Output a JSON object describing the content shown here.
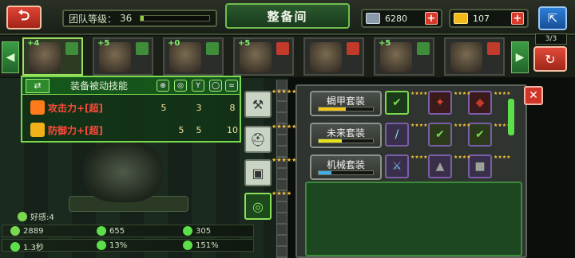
{
  "header": {
    "back_icon": "back-arrow-icon",
    "level_label": "团队等级：",
    "level_value": "36",
    "level_progress": 0.04,
    "title": "整备间",
    "resource1_value": "6280",
    "resource2_value": "107",
    "plus": "+",
    "share_icon": "share-icon"
  },
  "roster": {
    "count": "3/3",
    "slots": [
      {
        "plus": "+4",
        "badge_color": "#3f8d3a",
        "selected": true
      },
      {
        "plus": "+5",
        "badge_color": "#3f8d3a",
        "selected": false
      },
      {
        "plus": "+0",
        "badge_color": "#3f8d3a",
        "selected": false
      },
      {
        "plus": "+5",
        "badge_color": "#c13a2a",
        "selected": false
      },
      {
        "plus": "",
        "badge_color": "#c13a2a",
        "selected": false
      },
      {
        "plus": "+5",
        "badge_color": "#3f8d3a",
        "selected": false
      },
      {
        "plus": "",
        "badge_color": "#c13a2a",
        "selected": false
      }
    ]
  },
  "skills": {
    "title": "装备被动技能",
    "rows": [
      {
        "name": "攻击力+[超]",
        "values": [
          "5",
          "",
          "3",
          "8"
        ],
        "icon_color": "#ff7a1a"
      },
      {
        "name": "防御力+[超]",
        "values": [
          "",
          "5",
          "5",
          "10"
        ],
        "icon_color": "#f2b01a"
      }
    ]
  },
  "stats": {
    "affinity": "好感:4",
    "hp": "2889",
    "attack": "655",
    "defense": "305",
    "speed": "1.3秒",
    "crit": "13%",
    "crit_dmg": "151%"
  },
  "sets": [
    {
      "label": "蝎甲套装",
      "fill": 0.5,
      "fill_color": "#f2c31a"
    },
    {
      "label": "未来套装",
      "fill": 0.42,
      "fill_color": "#e8e21a"
    },
    {
      "label": "机械套装",
      "fill": 0.24,
      "fill_color": "#41b0e8"
    }
  ],
  "colors": {
    "accent_green": "#7bd94e",
    "danger_red": "#d0352a"
  }
}
